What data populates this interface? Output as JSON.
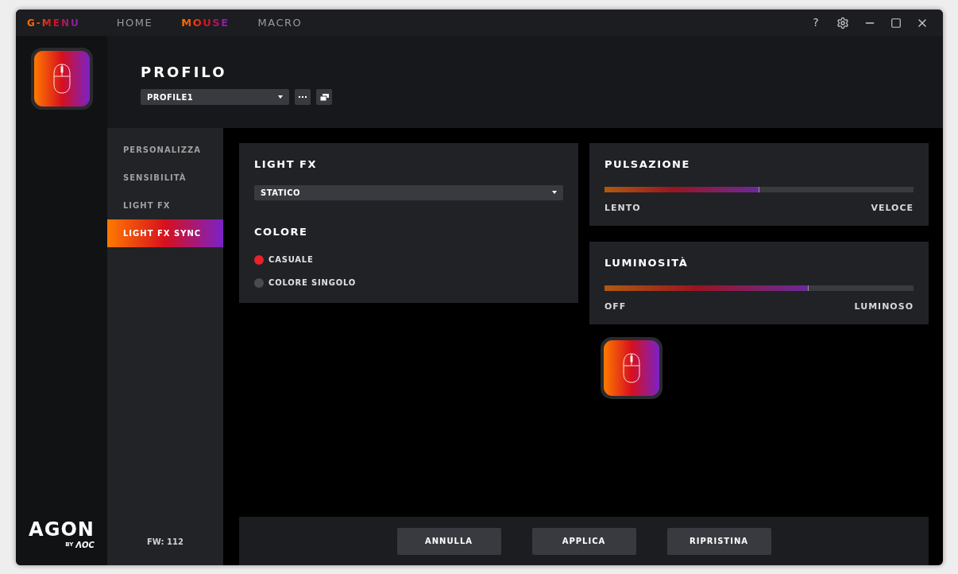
{
  "app": {
    "brand": "G-MENU"
  },
  "nav_tabs": [
    {
      "label": "HOME",
      "selected": false
    },
    {
      "label": "MOUSE",
      "selected": true
    },
    {
      "label": "MACRO",
      "selected": false
    }
  ],
  "window_controls": {
    "help": "?"
  },
  "profile": {
    "title": "PROFILO",
    "selected_profile": "PROFILE1"
  },
  "side_menu": [
    {
      "label": "PERSONALIZZA",
      "selected": false
    },
    {
      "label": "SENSIBILITÀ",
      "selected": false
    },
    {
      "label": "LIGHT FX",
      "selected": false
    },
    {
      "label": "LIGHT FX SYNC",
      "selected": true
    }
  ],
  "logo": {
    "name": "AGON",
    "by": "BY",
    "maker": "ΛOC"
  },
  "firmware": "FW: 112",
  "light_fx": {
    "title": "LIGHT FX",
    "effect": "STATICO",
    "color_title": "COLORE",
    "color_options": [
      {
        "label": "CASUALE",
        "selected": true
      },
      {
        "label": "COLORE SINGOLO",
        "selected": false
      }
    ]
  },
  "sliders": [
    {
      "title": "PULSAZIONE",
      "level": 0.5,
      "min_label": "LENTO",
      "max_label": "VELOCE"
    },
    {
      "title": "LUMINOSITÀ",
      "level": 0.66,
      "min_label": "OFF",
      "max_label": "LUMINOSO"
    }
  ],
  "buttons": [
    "ANNULLA",
    "APPLICA",
    "RIPRISTINA"
  ]
}
